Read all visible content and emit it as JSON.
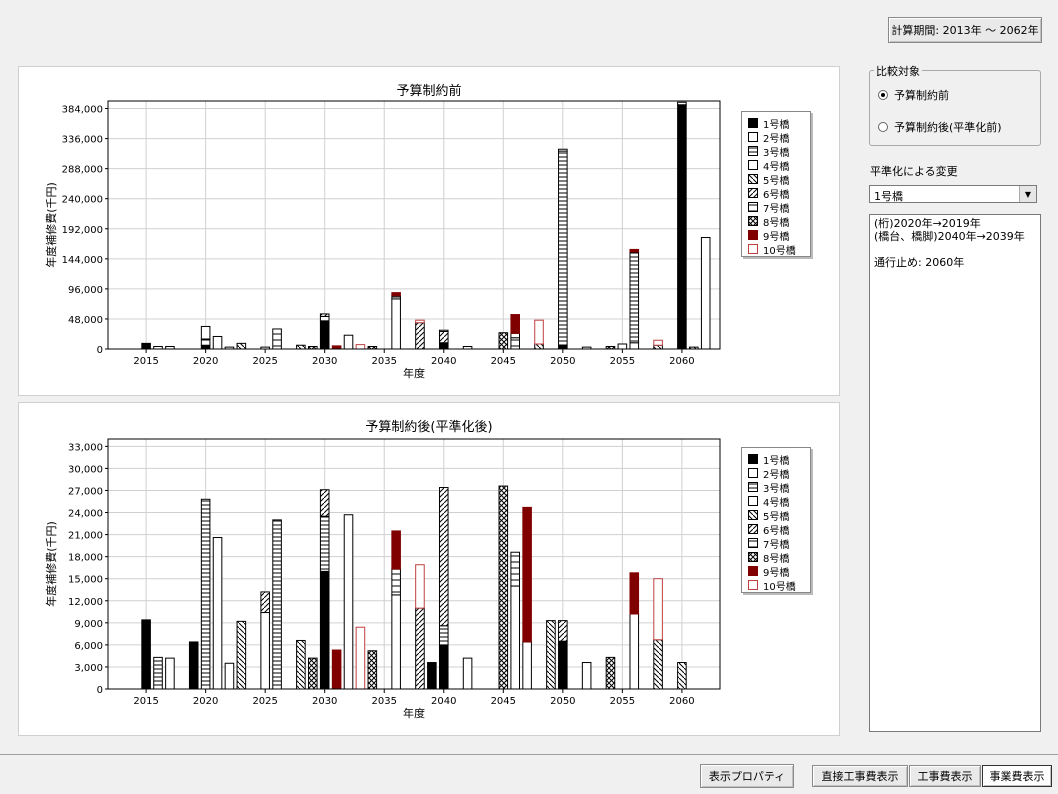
{
  "period_button": "計算期間: 2013年 ～ 2062年",
  "compare_group": {
    "label": "比較対象",
    "options": [
      "予算制約前",
      "予算制約後(平準化前)"
    ],
    "selected": 0
  },
  "leveling": {
    "label": "平準化による変更",
    "selected": "1号橋",
    "notes": [
      "(桁)2020年→2019年",
      "(橋台、橋脚)2040年→2039年",
      "",
      "通行止め: 2060年"
    ]
  },
  "footer": {
    "props_button": "表示プロパティ",
    "tabs": [
      "直接工事費表示",
      "工事費表示",
      "事業費表示"
    ]
  },
  "colors": {
    "black": "#000000",
    "dark_red": "#800000",
    "red_outline": "#c04040"
  },
  "chart_data": [
    {
      "type": "bar",
      "stacked": true,
      "title": "予算制約前",
      "xlabel": "年度",
      "ylabel": "年度補修費(千円)",
      "ylim": [
        0,
        396000
      ],
      "yticks": [
        "0",
        "48,000",
        "96,000",
        "144,000",
        "192,000",
        "240,000",
        "288,000",
        "336,000",
        "384,000"
      ],
      "ytick_values": [
        0,
        48000,
        96000,
        144000,
        192000,
        240000,
        288000,
        336000,
        384000
      ],
      "xlim": [
        2011.8,
        2063.2
      ],
      "xticks": [
        "2015",
        "2020",
        "2025",
        "2030",
        "2035",
        "2040",
        "2045",
        "2050",
        "2055",
        "2060"
      ],
      "xtick_values": [
        2015,
        2020,
        2025,
        2030,
        2035,
        2040,
        2045,
        2050,
        2055,
        2060
      ],
      "legend_position": "right",
      "legend": [
        "1号橋",
        "2号橋",
        "3号橋",
        "4号橋",
        "5号橋",
        "6号橋",
        "7号橋",
        "8号橋",
        "9号橋",
        "10号橋"
      ],
      "bars": [
        {
          "year": 2015,
          "segments": [
            {
              "s": 0,
              "v": 9000
            }
          ]
        },
        {
          "year": 2016,
          "segments": [
            {
              "s": 2,
              "v": 4000
            }
          ]
        },
        {
          "year": 2017,
          "segments": [
            {
              "s": 1,
              "v": 4000
            }
          ]
        },
        {
          "year": 2020,
          "segments": [
            {
              "s": 0,
              "v": 6000
            },
            {
              "s": 6,
              "v": 10000
            },
            {
              "s": 3,
              "v": 20000
            }
          ]
        },
        {
          "year": 2021,
          "segments": [
            {
              "s": 1,
              "v": 20000
            }
          ]
        },
        {
          "year": 2022,
          "segments": [
            {
              "s": 1,
              "v": 3000
            }
          ]
        },
        {
          "year": 2023,
          "segments": [
            {
              "s": 4,
              "v": 9000
            }
          ]
        },
        {
          "year": 2025,
          "segments": [
            {
              "s": 2,
              "v": 3000
            }
          ]
        },
        {
          "year": 2026,
          "segments": [
            {
              "s": 6,
              "v": 32000
            }
          ]
        },
        {
          "year": 2028,
          "segments": [
            {
              "s": 4,
              "v": 6000
            }
          ]
        },
        {
          "year": 2029,
          "segments": [
            {
              "s": 7,
              "v": 4000
            }
          ]
        },
        {
          "year": 2030,
          "segments": [
            {
              "s": 0,
              "v": 45000
            },
            {
              "s": 6,
              "v": 7000
            },
            {
              "s": 5,
              "v": 4000
            }
          ]
        },
        {
          "year": 2031,
          "segments": [
            {
              "s": 8,
              "v": 5000
            }
          ]
        },
        {
          "year": 2032,
          "segments": [
            {
              "s": 1,
              "v": 22000
            }
          ]
        },
        {
          "year": 2033,
          "segments": [
            {
              "s": 9,
              "v": 7000
            }
          ]
        },
        {
          "year": 2034,
          "segments": [
            {
              "s": 7,
              "v": 4000
            }
          ]
        },
        {
          "year": 2036,
          "segments": [
            {
              "s": 1,
              "v": 80000
            },
            {
              "s": 2,
              "v": 5000
            },
            {
              "s": 8,
              "v": 5000
            }
          ]
        },
        {
          "year": 2038,
          "segments": [
            {
              "s": 5,
              "v": 42000
            },
            {
              "s": 9,
              "v": 4000
            }
          ]
        },
        {
          "year": 2040,
          "segments": [
            {
              "s": 0,
              "v": 10000
            },
            {
              "s": 5,
              "v": 18000
            },
            {
              "s": 2,
              "v": 2000
            }
          ]
        },
        {
          "year": 2042,
          "segments": [
            {
              "s": 1,
              "v": 4000
            }
          ]
        },
        {
          "year": 2045,
          "segments": [
            {
              "s": 7,
              "v": 26000
            }
          ]
        },
        {
          "year": 2046,
          "segments": [
            {
              "s": 6,
              "v": 18000
            },
            {
              "s": 1,
              "v": 7000
            },
            {
              "s": 8,
              "v": 30000
            }
          ]
        },
        {
          "year": 2048,
          "segments": [
            {
              "s": 4,
              "v": 8000
            },
            {
              "s": 9,
              "v": 38000
            }
          ]
        },
        {
          "year": 2050,
          "segments": [
            {
              "s": 0,
              "v": 6000
            },
            {
              "s": 2,
              "v": 310000
            },
            {
              "s": 3,
              "v": 3000
            }
          ]
        },
        {
          "year": 2052,
          "segments": [
            {
              "s": 1,
              "v": 3000
            }
          ]
        },
        {
          "year": 2054,
          "segments": [
            {
              "s": 7,
              "v": 4000
            }
          ]
        },
        {
          "year": 2055,
          "segments": [
            {
              "s": 3,
              "v": 8000
            }
          ]
        },
        {
          "year": 2056,
          "segments": [
            {
              "s": 1,
              "v": 10000
            },
            {
              "s": 2,
              "v": 145000
            },
            {
              "s": 8,
              "v": 4000
            }
          ]
        },
        {
          "year": 2058,
          "segments": [
            {
              "s": 4,
              "v": 6000
            },
            {
              "s": 9,
              "v": 8000
            }
          ]
        },
        {
          "year": 2060,
          "segments": [
            {
              "s": 0,
              "v": 390000
            },
            {
              "s": 6,
              "v": 4000
            }
          ]
        },
        {
          "year": 2061,
          "segments": [
            {
              "s": 4,
              "v": 3000
            }
          ]
        },
        {
          "year": 2062,
          "segments": [
            {
              "s": 1,
              "v": 178000
            }
          ]
        }
      ]
    },
    {
      "type": "bar",
      "stacked": true,
      "title": "予算制約後(平準化後)",
      "xlabel": "年度",
      "ylabel": "年度補修費(千円)",
      "ylim": [
        0,
        34000
      ],
      "yticks": [
        "0",
        "3,000",
        "6,000",
        "9,000",
        "12,000",
        "15,000",
        "18,000",
        "21,000",
        "24,000",
        "27,000",
        "30,000",
        "33,000"
      ],
      "ytick_values": [
        0,
        3000,
        6000,
        9000,
        12000,
        15000,
        18000,
        21000,
        24000,
        27000,
        30000,
        33000
      ],
      "xlim": [
        2011.8,
        2063.2
      ],
      "xticks": [
        "2015",
        "2020",
        "2025",
        "2030",
        "2035",
        "2040",
        "2045",
        "2050",
        "2055",
        "2060"
      ],
      "xtick_values": [
        2015,
        2020,
        2025,
        2030,
        2035,
        2040,
        2045,
        2050,
        2055,
        2060
      ],
      "legend_position": "right",
      "legend": [
        "1号橋",
        "2号橋",
        "3号橋",
        "4号橋",
        "5号橋",
        "6号橋",
        "7号橋",
        "8号橋",
        "9号橋",
        "10号橋"
      ],
      "bars": [
        {
          "year": 2015,
          "segments": [
            {
              "s": 0,
              "v": 9400
            }
          ]
        },
        {
          "year": 2016,
          "segments": [
            {
              "s": 2,
              "v": 4300
            }
          ]
        },
        {
          "year": 2017,
          "segments": [
            {
              "s": 1,
              "v": 4200
            }
          ]
        },
        {
          "year": 2019,
          "segments": [
            {
              "s": 0,
              "v": 6400
            }
          ]
        },
        {
          "year": 2020,
          "segments": [
            {
              "s": 2,
              "v": 25800
            }
          ]
        },
        {
          "year": 2021,
          "segments": [
            {
              "s": 1,
              "v": 20600
            }
          ]
        },
        {
          "year": 2022,
          "segments": [
            {
              "s": 1,
              "v": 3500
            }
          ]
        },
        {
          "year": 2023,
          "segments": [
            {
              "s": 4,
              "v": 9200
            }
          ]
        },
        {
          "year": 2025,
          "segments": [
            {
              "s": 1,
              "v": 10400
            },
            {
              "s": 5,
              "v": 2800
            }
          ]
        },
        {
          "year": 2026,
          "segments": [
            {
              "s": 2,
              "v": 23000
            }
          ]
        },
        {
          "year": 2028,
          "segments": [
            {
              "s": 4,
              "v": 6600
            }
          ]
        },
        {
          "year": 2029,
          "segments": [
            {
              "s": 7,
              "v": 4200
            }
          ]
        },
        {
          "year": 2030,
          "segments": [
            {
              "s": 0,
              "v": 16000
            },
            {
              "s": 2,
              "v": 7500
            },
            {
              "s": 5,
              "v": 3600
            }
          ]
        },
        {
          "year": 2031,
          "segments": [
            {
              "s": 8,
              "v": 5300
            }
          ]
        },
        {
          "year": 2032,
          "segments": [
            {
              "s": 1,
              "v": 23700
            }
          ]
        },
        {
          "year": 2033,
          "segments": [
            {
              "s": 9,
              "v": 8400
            }
          ]
        },
        {
          "year": 2034,
          "segments": [
            {
              "s": 7,
              "v": 5200
            }
          ]
        },
        {
          "year": 2036,
          "segments": [
            {
              "s": 1,
              "v": 12800
            },
            {
              "s": 6,
              "v": 3500
            },
            {
              "s": 8,
              "v": 5200
            }
          ]
        },
        {
          "year": 2038,
          "segments": [
            {
              "s": 5,
              "v": 11000
            },
            {
              "s": 9,
              "v": 5900
            }
          ]
        },
        {
          "year": 2039,
          "segments": [
            {
              "s": 0,
              "v": 3600
            }
          ]
        },
        {
          "year": 2040,
          "segments": [
            {
              "s": 0,
              "v": 6000
            },
            {
              "s": 2,
              "v": 2600
            },
            {
              "s": 5,
              "v": 18800
            }
          ]
        },
        {
          "year": 2042,
          "segments": [
            {
              "s": 1,
              "v": 4200
            }
          ]
        },
        {
          "year": 2045,
          "segments": [
            {
              "s": 7,
              "v": 27600
            }
          ]
        },
        {
          "year": 2046,
          "segments": [
            {
              "s": 1,
              "v": 14000
            },
            {
              "s": 6,
              "v": 4600
            }
          ]
        },
        {
          "year": 2047,
          "segments": [
            {
              "s": 1,
              "v": 6400
            },
            {
              "s": 8,
              "v": 18300
            }
          ]
        },
        {
          "year": 2049,
          "segments": [
            {
              "s": 4,
              "v": 9300
            }
          ]
        },
        {
          "year": 2050,
          "segments": [
            {
              "s": 0,
              "v": 6500
            },
            {
              "s": 5,
              "v": 2800
            }
          ]
        },
        {
          "year": 2052,
          "segments": [
            {
              "s": 1,
              "v": 3600
            }
          ]
        },
        {
          "year": 2054,
          "segments": [
            {
              "s": 7,
              "v": 4300
            }
          ]
        },
        {
          "year": 2056,
          "segments": [
            {
              "s": 1,
              "v": 10200
            },
            {
              "s": 8,
              "v": 5600
            }
          ]
        },
        {
          "year": 2058,
          "segments": [
            {
              "s": 4,
              "v": 6700
            },
            {
              "s": 9,
              "v": 8300
            }
          ]
        },
        {
          "year": 2060,
          "segments": [
            {
              "s": 4,
              "v": 3600
            }
          ]
        }
      ]
    }
  ]
}
